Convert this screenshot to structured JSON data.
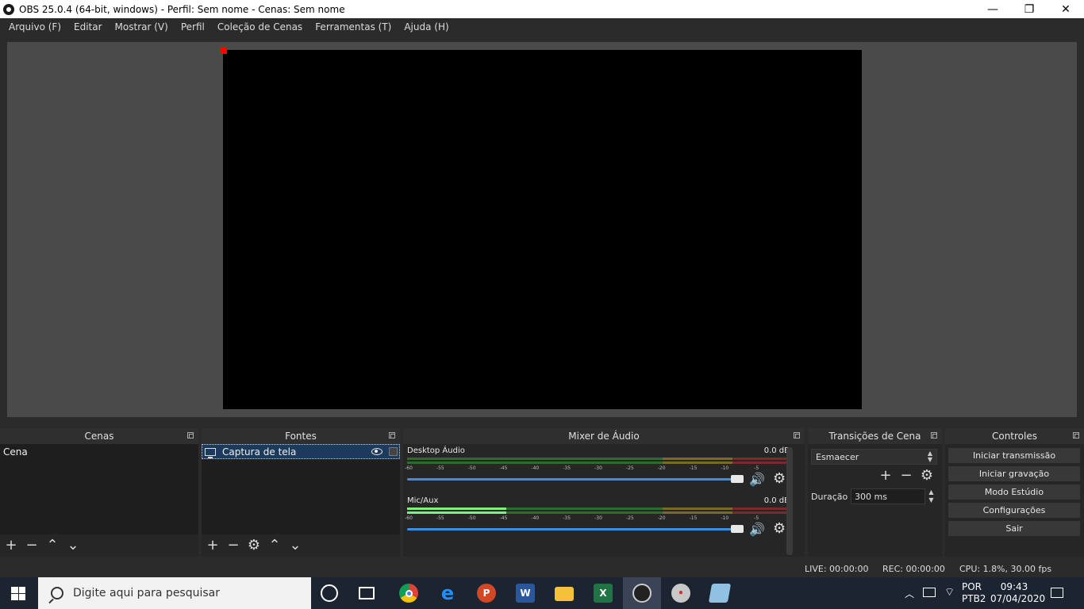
{
  "window": {
    "title": "OBS 25.0.4 (64-bit, windows) - Perfil: Sem nome - Cenas: Sem nome",
    "minimize_glyph": "—",
    "maximize_glyph": "❐",
    "close_glyph": "✕"
  },
  "menu": [
    "Arquivo (F)",
    "Editar",
    "Mostrar (V)",
    "Perfil",
    "Coleção de Cenas",
    "Ferramentas (T)",
    "Ajuda (H)"
  ],
  "docks": {
    "scenes": {
      "title": "Cenas",
      "items": [
        "Cena"
      ]
    },
    "sources": {
      "title": "Fontes",
      "items": [
        "Captura de tela"
      ]
    },
    "mixer": {
      "title": "Mixer de Áudio",
      "channels": [
        {
          "name": "Desktop Áudio",
          "db": "0.0 dB",
          "level": 0
        },
        {
          "name": "Mic/Aux",
          "db": "0.0 dB",
          "level": 0.26
        }
      ],
      "ticks": [
        "-60",
        "-55",
        "-50",
        "-45",
        "-40",
        "-35",
        "-30",
        "-25",
        "-20",
        "-15",
        "-10",
        "-5",
        "0"
      ]
    },
    "transitions": {
      "title": "Transições de Cena",
      "selected": "Esmaecer",
      "duration_label": "Duração",
      "duration_value": "300 ms"
    },
    "controls": {
      "title": "Controles",
      "buttons": [
        "Iniciar transmissão",
        "Iniciar gravação",
        "Modo Estúdio",
        "Configurações",
        "Sair"
      ]
    }
  },
  "status": {
    "live": "LIVE: 00:00:00",
    "rec": "REC: 00:00:00",
    "cpu": "CPU: 1.8%, 30.00 fps"
  },
  "taskbar": {
    "search_placeholder": "Digite aqui para pesquisar",
    "lang_top": "POR",
    "lang_bottom": "PTB2",
    "time": "09:43",
    "date": "07/04/2020",
    "apps": [
      "cortana-icon",
      "task-view-icon",
      "chrome-icon",
      "edge-icon",
      "powerpoint-icon",
      "word-icon",
      "file-explorer-icon",
      "excel-icon",
      "obs-icon",
      "paint-icon",
      "notepad-icon"
    ]
  }
}
